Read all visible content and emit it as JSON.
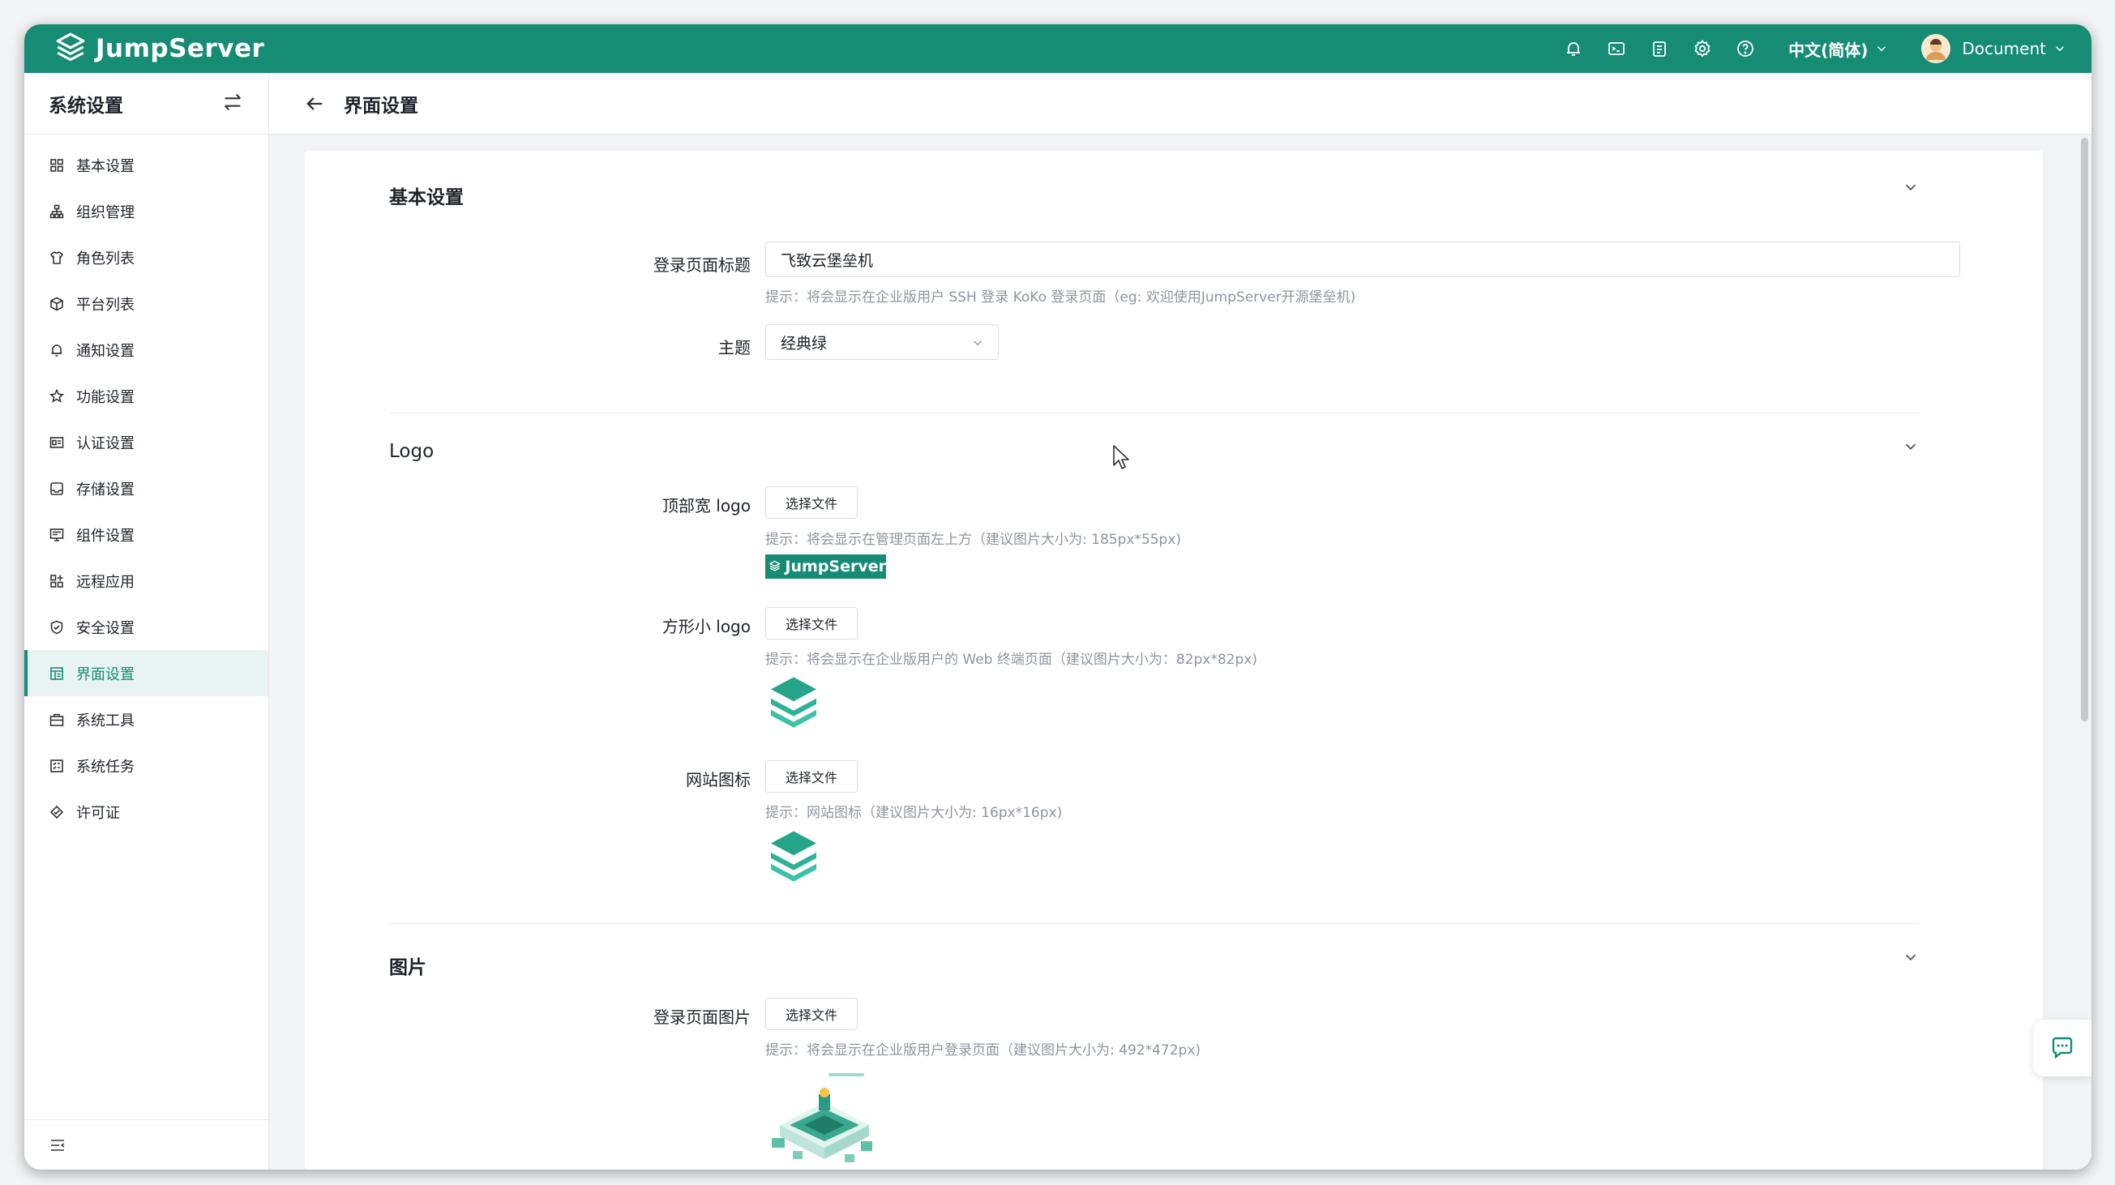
{
  "topbar": {
    "brand": "JumpServer",
    "language": "中文(简体)",
    "user": "Document",
    "icons": [
      "bell-icon",
      "terminal-icon",
      "clipboard-icon",
      "gear-icon",
      "help-icon"
    ]
  },
  "sidebar": {
    "title": "系统设置",
    "items": [
      {
        "label": "基本设置",
        "icon": "grid-icon"
      },
      {
        "label": "组织管理",
        "icon": "org-icon"
      },
      {
        "label": "角色列表",
        "icon": "shirt-icon"
      },
      {
        "label": "平台列表",
        "icon": "cube-icon"
      },
      {
        "label": "通知设置",
        "icon": "bell-icon"
      },
      {
        "label": "功能设置",
        "icon": "star-icon"
      },
      {
        "label": "认证设置",
        "icon": "id-card-icon"
      },
      {
        "label": "存储设置",
        "icon": "inbox-icon"
      },
      {
        "label": "组件设置",
        "icon": "monitor-icon"
      },
      {
        "label": "远程应用",
        "icon": "apps-icon"
      },
      {
        "label": "安全设置",
        "icon": "shield-icon"
      },
      {
        "label": "界面设置",
        "icon": "layout-icon",
        "active": true
      },
      {
        "label": "系统工具",
        "icon": "toolbox-icon"
      },
      {
        "label": "系统任务",
        "icon": "tasks-icon"
      },
      {
        "label": "许可证",
        "icon": "badge-icon"
      }
    ]
  },
  "main": {
    "title": "界面设置"
  },
  "sections": {
    "basic": {
      "title": "基本设置",
      "login_title_label": "登录页面标题",
      "login_title_value": "飞致云堡垒机",
      "login_title_hint": "提示：将会显示在企业版用户 SSH 登录 KoKo 登录页面（eg: 欢迎使用JumpServer开源堡垒机)",
      "theme_label": "主题",
      "theme_value": "经典绿"
    },
    "logo": {
      "title": "Logo",
      "wide_label": "顶部宽 logo",
      "wide_hint": "提示：将会显示在管理页面左上方（建议图片大小为: 185px*55px)",
      "wide_logo_text": "JumpServer",
      "square_label": "方形小 logo",
      "square_hint": "提示：将会显示在企业版用户的 Web 终端页面（建议图片大小为：82px*82px)",
      "favicon_label": "网站图标",
      "favicon_hint": "提示：网站图标（建议图片大小为: 16px*16px)",
      "choose_file": "选择文件"
    },
    "image": {
      "title": "图片",
      "login_image_label": "登录页面图片",
      "login_image_hint": "提示：将会显示在企业版用户登录页面（建议图片大小为: 492*472px)",
      "choose_file": "选择文件"
    }
  },
  "colors": {
    "brand": "#168c75",
    "active_bg": "#e7f4f1",
    "hint": "#8f959e"
  }
}
